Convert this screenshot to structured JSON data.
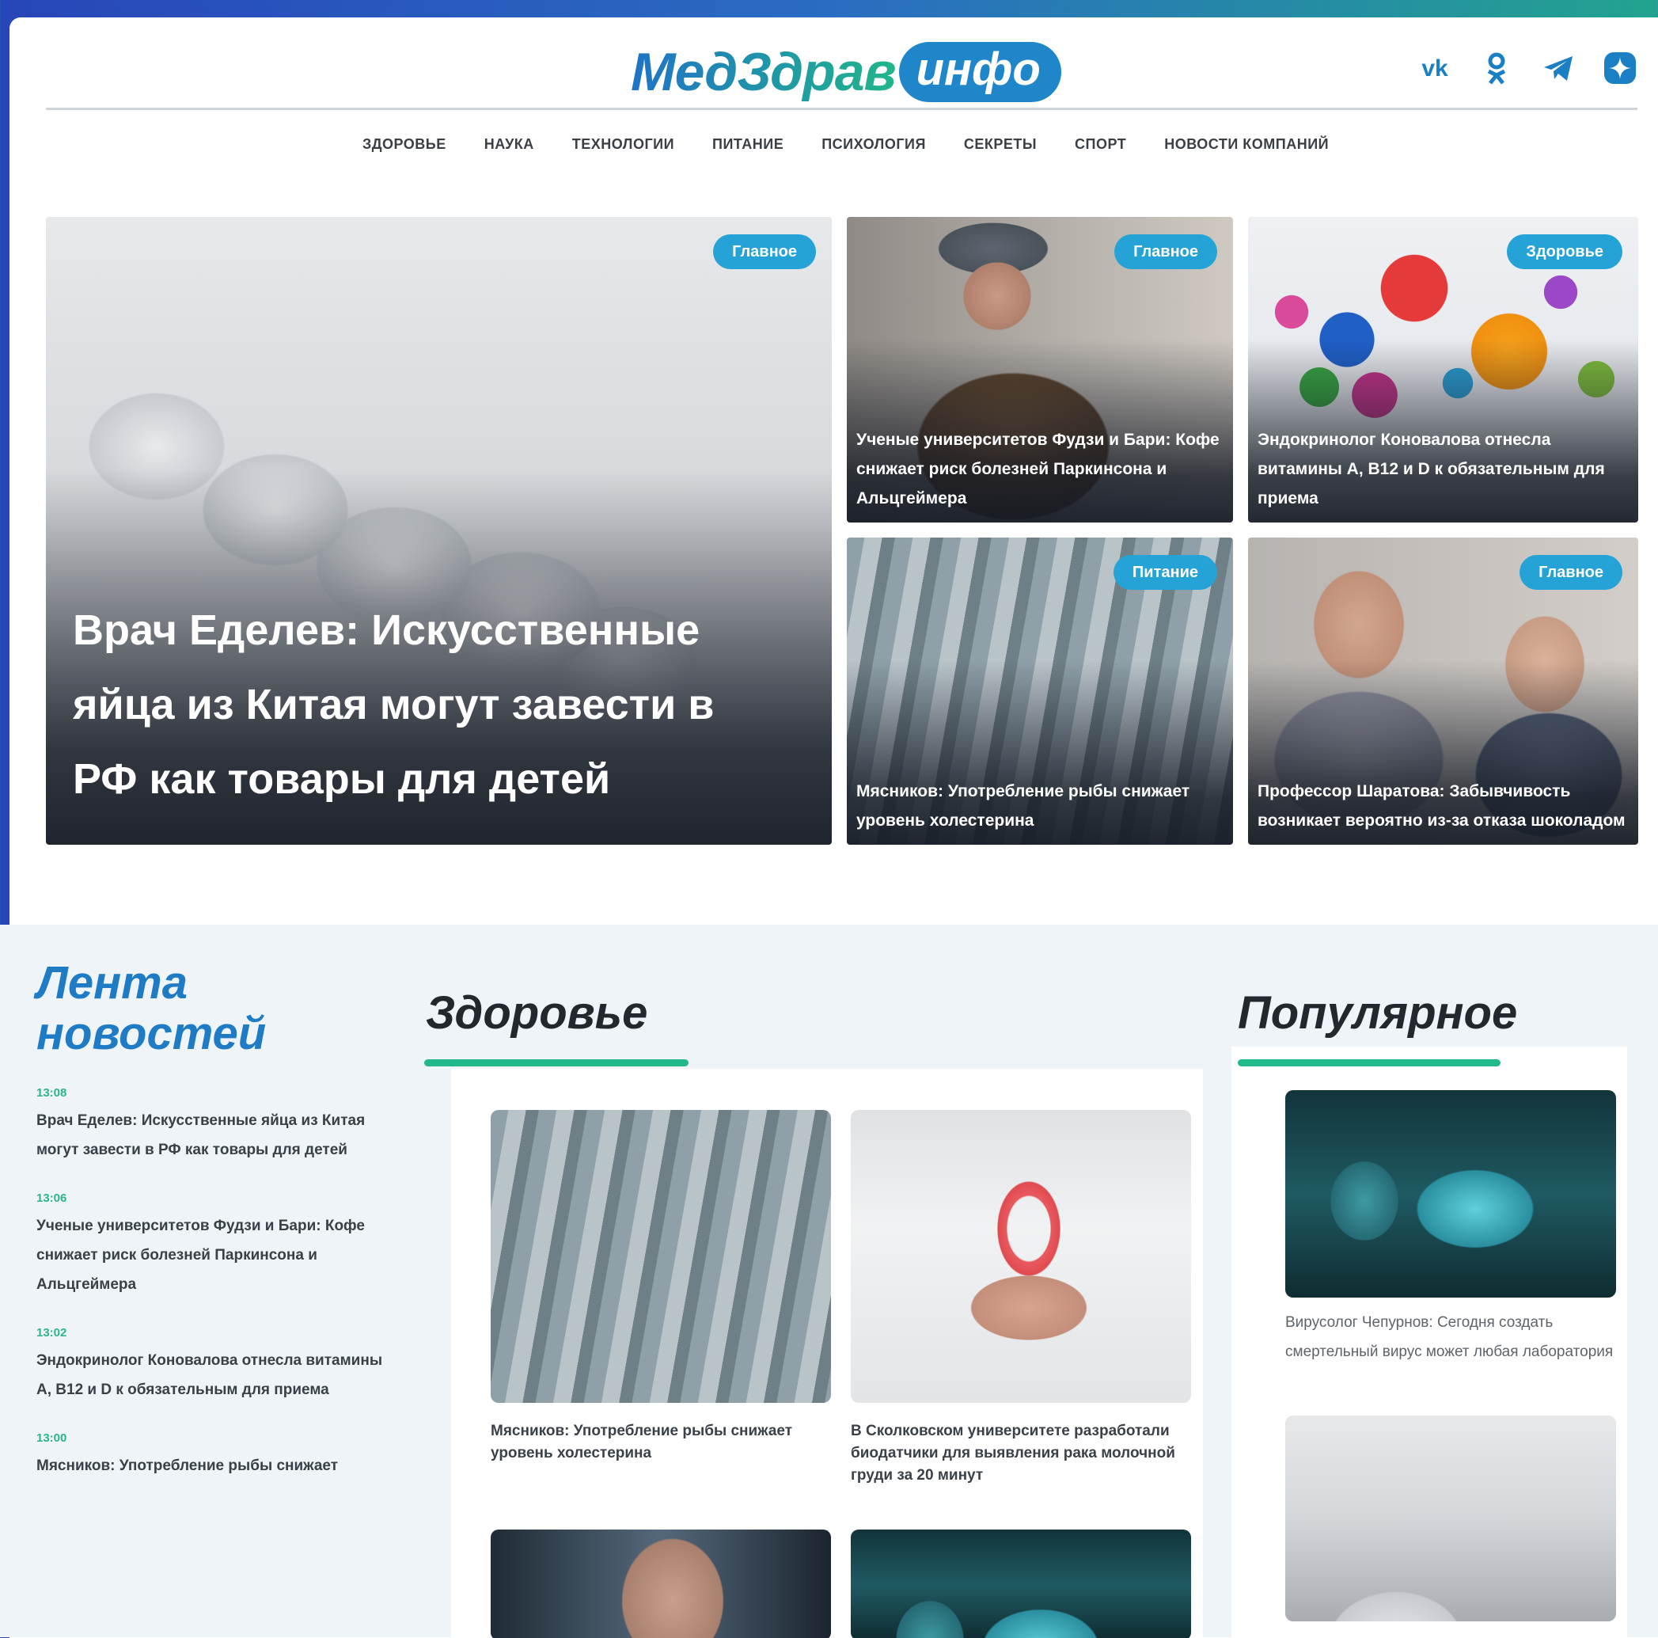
{
  "site": {
    "logo_main": "МедЗдрав",
    "logo_pill": "инфо",
    "socials": [
      {
        "name": "vk-icon",
        "label": "vk"
      },
      {
        "name": "odnoklassniki-icon",
        "label": ""
      },
      {
        "name": "telegram-icon",
        "label": ""
      },
      {
        "name": "dzen-icon",
        "label": ""
      }
    ]
  },
  "nav": [
    "ЗДОРОВЬЕ",
    "НАУКА",
    "ТЕХНОЛОГИИ",
    "ПИТАНИЕ",
    "ПСИХОЛОГИЯ",
    "СЕКРЕТЫ",
    "СПОРТ",
    "НОВОСТИ КОМПАНИЙ"
  ],
  "hero": {
    "main": {
      "badge": "Главное",
      "title": "Врач Еделев: Искусственные яйца из Китая могут завести в РФ как товары для детей"
    },
    "cards": [
      {
        "badge": "Главное",
        "title": "Ученые университетов Фудзи и Бари: Кофе снижает риск болезней Паркинсона и Альцгеймера"
      },
      {
        "badge": "Здоровье",
        "title": "Эндокринолог Коновалова отнесла витамины A, B12 и D к обязательным для приема"
      },
      {
        "badge": "Питание",
        "title": "Мясников: Употребление рыбы снижает уровень холестерина"
      },
      {
        "badge": "Главное",
        "title": "Профессор Шаратова: Забывчивость возникает вероятно из-за отказа шоколадом"
      }
    ]
  },
  "feed": {
    "title_line1": "Лента",
    "title_line2": "новостей",
    "items": [
      {
        "time": "13:08",
        "text": "Врач Еделев: Искусственные яйца из Китая могут завести в РФ как товары для детей"
      },
      {
        "time": "13:06",
        "text": "Ученые университетов Фудзи и Бари: Кофе снижает риск болезней Паркинсона и Альцгеймера"
      },
      {
        "time": "13:02",
        "text": "Эндокринолог Коновалова отнесла витамины A, B12 и D к обязательным для приема"
      },
      {
        "time": "13:00",
        "text": "Мясников: Употребление рыбы снижает"
      }
    ]
  },
  "health": {
    "title": "Здоровье",
    "cards": [
      {
        "text": "Мясников: Употребление рыбы снижает уровень холестерина"
      },
      {
        "text": "В Сколковском университете разработали биодатчики для выявления рака молочной груди за 20 минут"
      }
    ]
  },
  "popular": {
    "title": "Популярное",
    "items": [
      {
        "text": "Вирусолог Чепурнов: Сегодня создать смертельный вирус может любая лаборатория"
      }
    ]
  },
  "colors": {
    "accent_blue": "#1f7cc4",
    "accent_green": "#24b98a",
    "badge": "#25a3d6"
  }
}
